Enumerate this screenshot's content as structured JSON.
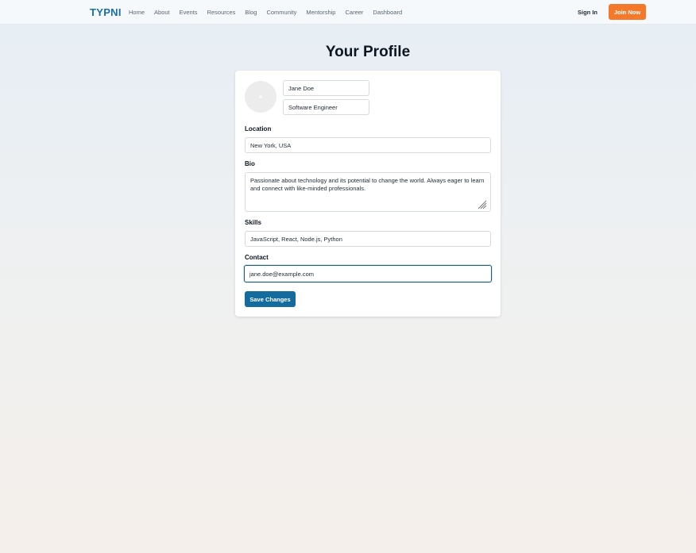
{
  "nav": {
    "brand": "TYPNI",
    "links": [
      "Home",
      "About",
      "Events",
      "Resources",
      "Blog",
      "Community",
      "Mentorship",
      "Career",
      "Dashboard"
    ],
    "signin": "Sign In",
    "join": "Join Now"
  },
  "page": {
    "title": "Your Profile"
  },
  "profile": {
    "name": "Jane Doe",
    "job_title": "Software Engineer",
    "location_label": "Location",
    "location": "New York, USA",
    "bio_label": "Bio",
    "bio": "Passionate about technology and its potential to change the world. Always eager to learn and connect with like-minded professionals.",
    "skills_label": "Skills",
    "skills": "JavaScript, React, Node.js, Python",
    "contact_label": "Contact",
    "contact": "jane.doe@example.com",
    "save_label": "Save Changes"
  },
  "colors": {
    "brand": "#1a6ea6",
    "join_button": "#f5792a",
    "save_button": "#146c9e",
    "focus_border": "#145e86"
  },
  "icons": {
    "avatar": "avatar-placeholder",
    "resize": "resize-grip-icon"
  }
}
